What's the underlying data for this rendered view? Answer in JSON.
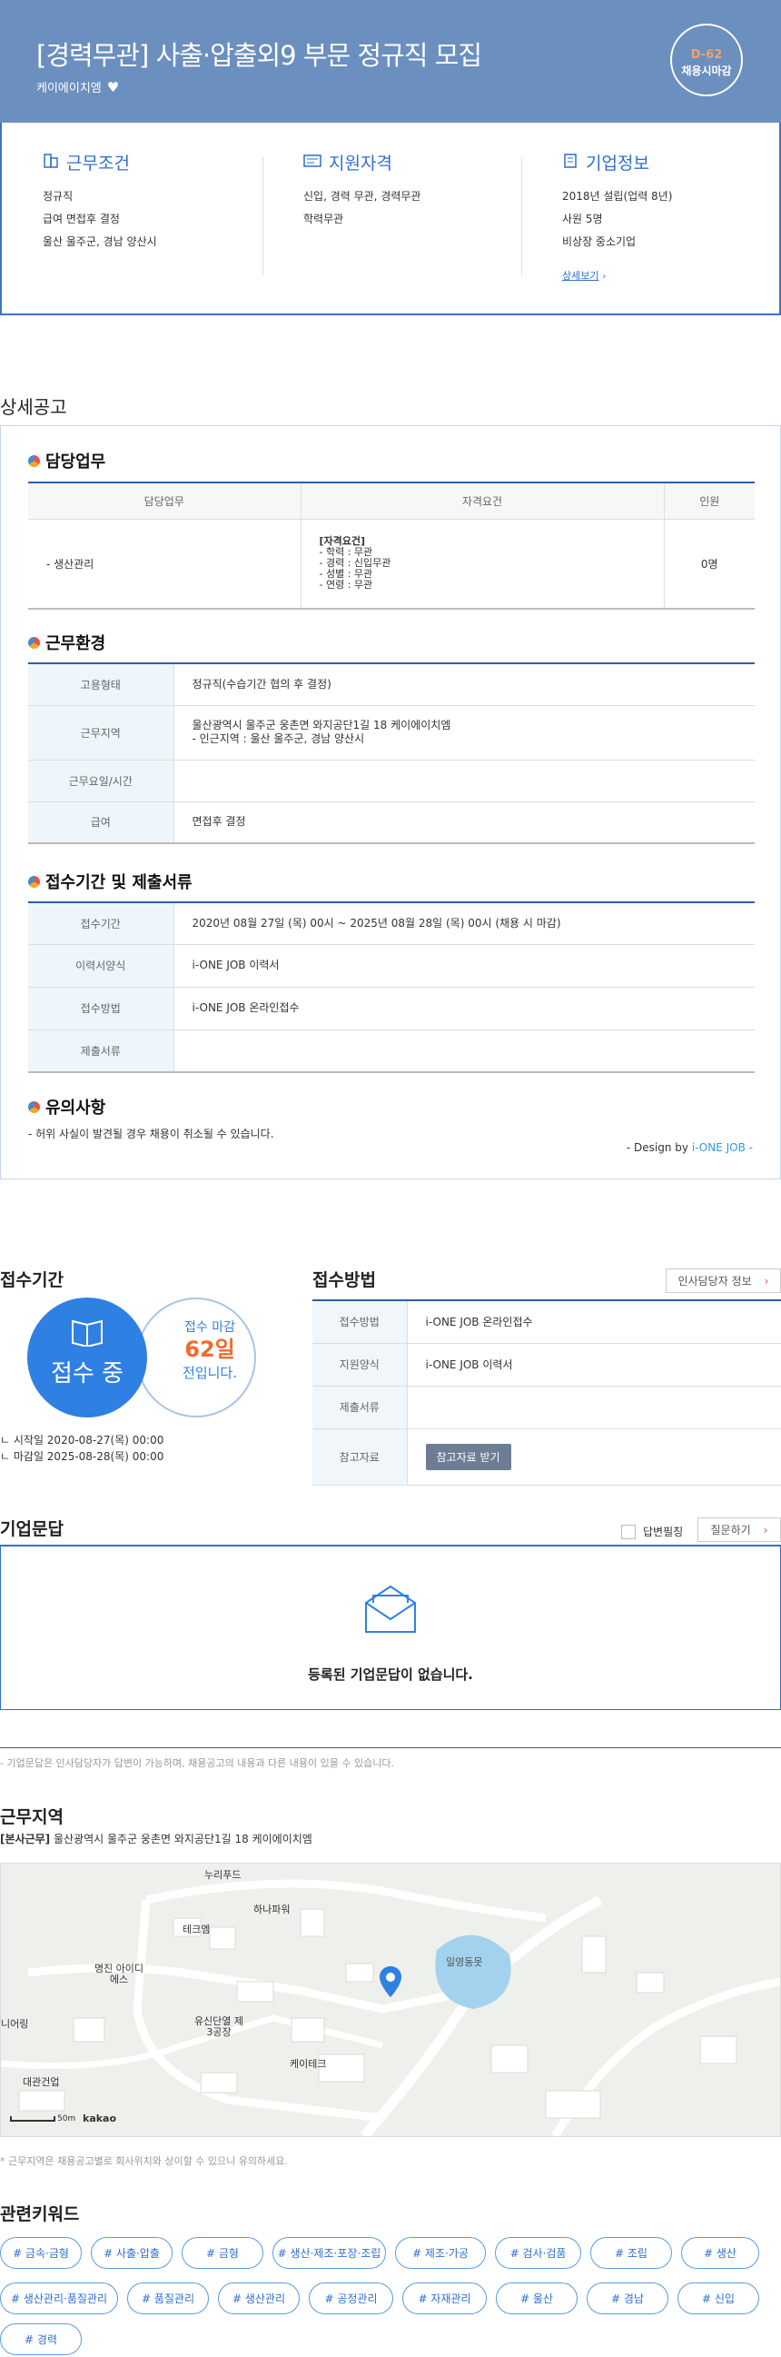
{
  "header": {
    "title": "[경력무관] 사출·압출외9 부문 정규직 모집",
    "company": "케이에이치엠",
    "dday": "D-62",
    "deadline_type": "채용시마감"
  },
  "summary": {
    "work": {
      "title": "근무조건",
      "lines": [
        "정규직",
        "급여 면접후 결정",
        "울산 울주군, 경남 양산시"
      ]
    },
    "apply": {
      "title": "지원자격",
      "lines": [
        "신입, 경력 무관, 경력무관",
        "학력무관"
      ]
    },
    "company": {
      "title": "기업정보",
      "lines": [
        "2018년 설립(업력 8년)",
        "사원 5명",
        "비상장 중소기업"
      ],
      "more": "상세보기"
    }
  },
  "detail": {
    "section_title": "상세공고",
    "duty": {
      "title": "담당업무",
      "headers": [
        "담당업무",
        "자격요건",
        "인원"
      ],
      "task": "- 생산관리",
      "req_heading": "[자격요건]",
      "req_lines": [
        "- 학력 : 무관",
        "- 경력 : 신입무관",
        "- 성별 : 무관",
        "- 연령 : 무관"
      ],
      "count": "0명"
    },
    "env": {
      "title": "근무환경",
      "rows": [
        {
          "label": "고용형태",
          "value": "정규직(수습기간 협의 후 결정)"
        },
        {
          "label": "근무지역",
          "value": "울산광역시 울주군 웅촌면 와지공단1길 18 케이에이치엠",
          "value2": "- 인근지역 : 울산 울주군, 경남 양산시"
        },
        {
          "label": "근무요일/시간",
          "value": ""
        },
        {
          "label": "급여",
          "value": "면접후 결정"
        }
      ]
    },
    "docs": {
      "title": "접수기간 및 제출서류",
      "rows": [
        {
          "label": "접수기간",
          "value": "2020년 08월 27일 (목) 00시 ~ 2025년 08월 28일 (목) 00시 (채용 시 마감)"
        },
        {
          "label": "이력서양식",
          "value": "i-ONE JOB 이력서"
        },
        {
          "label": "접수방법",
          "value": "i-ONE JOB 온라인접수"
        },
        {
          "label": "제출서류",
          "value": ""
        }
      ]
    },
    "notice": {
      "title": "유의사항",
      "text": "- 허위 사실이 발견될 경우 채용이 취소될 수 있습니다.",
      "design_prefix": "- Design by ",
      "design_brand": "i-ONE JOB -"
    }
  },
  "period": {
    "title": "접수기간",
    "status": "접수 중",
    "deadline_label": "접수 마감",
    "days": "62일",
    "days_suffix": "전입니다.",
    "start": "시작일 2020-08-27(목) 00:00",
    "end": "마감일 2025-08-28(목) 00:00"
  },
  "method": {
    "title": "접수방법",
    "hr_button": "인사담당자 정보",
    "rows": [
      {
        "label": "접수방법",
        "value": "i-ONE JOB 온라인접수"
      },
      {
        "label": "지원양식",
        "value": "i-ONE JOB 이력서"
      },
      {
        "label": "제출서류",
        "value": ""
      },
      {
        "label": "참고자료",
        "button": "참고자료 받기"
      }
    ]
  },
  "qa": {
    "title": "기업문답",
    "checkbox_label": "답변필칭",
    "ask_button": "질문하기",
    "empty": "등록된 기업문답이 없습니다.",
    "note": "- 기업문답은 인사담당자가 답변이 가능하며, 채용공고의 내용과 다른 내용이 있을 수 있습니다."
  },
  "location": {
    "title": "근무지역",
    "label": "[본사근무]",
    "address": "울산광역시 울주군 웅촌면 와지공단1길 18 케이에이치엠",
    "map_labels": [
      "누리푸드",
      "하나파워",
      "테크엠",
      "명진 아이디에스",
      "유신단열 제3공장",
      "케이테크",
      "니어링",
      "대관건업",
      "일영동못"
    ],
    "scale": "50m",
    "brand": "kakao",
    "note": "* 근무지역은 채용공고별로 회사위치와 상이할 수 있으니 유의하세요."
  },
  "keywords": {
    "title": "관련키워드",
    "items": [
      "# 금속·금형",
      "# 사출·압출",
      "# 금형",
      "# 생산·제조·포장·조립",
      "# 제조·가공",
      "# 검사·검품",
      "# 조립",
      "# 생산",
      "# 생산관리·품질관리",
      "# 품질관리",
      "# 생산관리",
      "# 공정관리",
      "# 자재관리",
      "# 울산",
      "# 경남",
      "# 신입",
      "# 경력"
    ]
  },
  "colors": {
    "header_bg": "#6b8fbe",
    "accent": "#2f6fcd",
    "dday": "#f5a26b",
    "days": "#f26a2e"
  }
}
